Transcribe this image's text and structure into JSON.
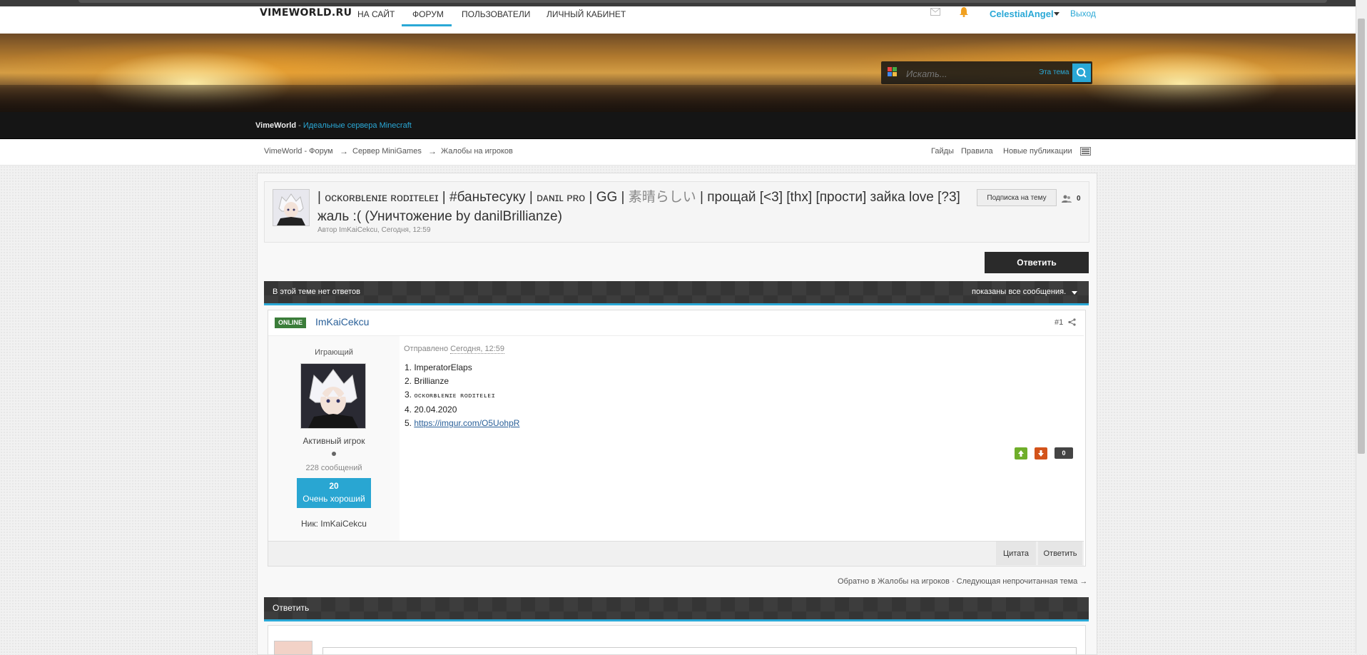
{
  "nav": {
    "logo": "VIMEWORLD.RU",
    "links": [
      "НА САЙТ",
      "ФОРУМ",
      "ПОЛЬЗОВАТЕЛИ",
      "ЛИЧНЫЙ КАБИНЕТ"
    ],
    "active_index": 1,
    "user": "CelestialAngel",
    "logout": "Выход"
  },
  "search": {
    "placeholder": "Искать...",
    "scope": "Эта тема"
  },
  "site": {
    "name": "VimeWorld",
    "separator": " - ",
    "tagline": "Идеальные сервера Minecraft"
  },
  "breadcrumbs": [
    "VimeWorld - Форум",
    "Сервер MiniGames",
    "Жалобы на игроков"
  ],
  "breadcrumb_arrow": "→",
  "toplinks": [
    "Гайды",
    "Правила",
    "Новые публикации"
  ],
  "topic": {
    "title_part1": "| ",
    "title_mono1": "ᴏᴄᴋᴏʀʙʟᴇɴɪᴇ ʀᴏᴅɪᴛᴇʟᴇɪ",
    "title_part2": " | #баньтесуку | ",
    "title_mono2": "ᴅᴀɴɪʟ ᴘʀᴏ",
    "title_part3": " | GG | ",
    "title_jp": "素晴らしい",
    "title_part4": " | прощай [<3] [thx] [прости] зайка love [?3] жаль :( (Уничтожение by danilBrillianze)",
    "meta": "Автор ImKaiCekcu, Сегодня, 12:59",
    "follow_label": "Подписка на тему",
    "followers": "0",
    "reply_label": "Ответить"
  },
  "posts_bar": {
    "left": "В этой теме нет ответов",
    "right": "показаны все сообщения."
  },
  "post": {
    "status": "ONLINE",
    "author": "ImKaiCekcu",
    "number": "#1",
    "group": "Играющий",
    "rank": "Активный игрок",
    "post_count": "228 сообщений",
    "reputation": "20",
    "reputation_label": "Очень хороший",
    "nick": "Ник: ImKaiCekcu",
    "date_prefix": "Отправлено ",
    "date": "Сегодня, 12:59",
    "lines": [
      "1. ImperatorElaps",
      "2. Brillianze",
      "3. ",
      "4. 20.04.2020",
      "5. "
    ],
    "line3_mono": "ᴏᴄᴋᴏʀʙʟᴇɴɪᴇ ʀᴏᴅɪᴛᴇʟᴇɪ",
    "link": "https://imgur.com/O5UohpR",
    "votes": "0",
    "quote_label": "Цитата",
    "reply_label": "Ответить"
  },
  "bottom_nav": "Обратно в Жалобы на игроков · Следующая непрочитанная тема →",
  "reply_section": {
    "label": "Ответить"
  },
  "colors": {
    "accent": "#2aa8d6",
    "dark_bar": "#353535",
    "online": "#3b7d3a",
    "vote_up": "#6fae2a",
    "vote_down": "#d3531a"
  }
}
